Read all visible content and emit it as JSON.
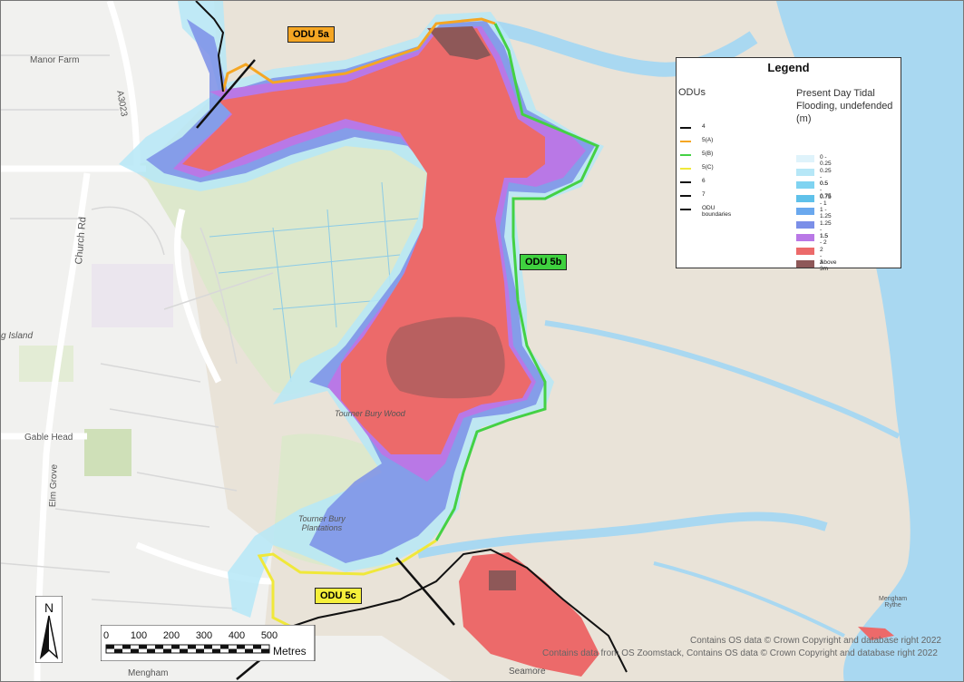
{
  "place_labels": {
    "manor_farm": "Manor Farm",
    "a3023": "A3023",
    "church_rd": "Church Rd",
    "island": "g Island",
    "gable_head": "Gable Head",
    "elm_grove": "Elm Grove",
    "tourner_bury_wood": "Tourner Bury Wood",
    "tourner_bury_plantations": "Tourner Bury\nPlantations",
    "mengham": "Mengham",
    "mengham_rythe": "Mengham\nRythe",
    "seamore": "Seamore"
  },
  "odu_labels": {
    "odu_5a": {
      "text": "ODU 5a",
      "color": "#f5a623"
    },
    "odu_5b": {
      "text": "ODU 5b",
      "color": "#3fd13f"
    },
    "odu_5c": {
      "text": "ODU 5c",
      "color": "#f5ef3a"
    }
  },
  "legend": {
    "title": "Legend",
    "odu_heading": "ODUs",
    "flood_heading": "Present Day Tidal Flooding, undefended (m)",
    "odu_items": [
      {
        "label": "4",
        "color": "#111111"
      },
      {
        "label": "5(A)",
        "color": "#f5a623"
      },
      {
        "label": "5(B)",
        "color": "#44d144"
      },
      {
        "label": "5(C)",
        "color": "#f0e83a"
      },
      {
        "label": "6",
        "color": "#111111"
      },
      {
        "label": "7",
        "color": "#111111"
      },
      {
        "label": "ODU boundaries",
        "color": "#111111"
      }
    ],
    "flood_items": [
      {
        "label": "0 - 0.25",
        "color": "#dff3fb"
      },
      {
        "label": "0.25 - 0.5",
        "color": "#b6e7f7"
      },
      {
        "label": "0.5 - 0.75",
        "color": "#7fd3f1"
      },
      {
        "label": "0.75 - 1",
        "color": "#5fc1ea"
      },
      {
        "label": "1 - 1.25",
        "color": "#6aa8ee"
      },
      {
        "label": "1.25 - 1.5",
        "color": "#7b8fe8"
      },
      {
        "label": "1.5 - 2",
        "color": "#b978e6"
      },
      {
        "label": "2 - 3",
        "color": "#ec6a6a"
      },
      {
        "label": "Above 3m",
        "color": "#8e5858"
      }
    ]
  },
  "scale_bar": {
    "ticks": [
      "0",
      "100",
      "200",
      "300",
      "400",
      "500"
    ],
    "unit": "Metres"
  },
  "north_arrow": {
    "label": "N"
  },
  "credits": {
    "line1": "Contains OS data © Crown Copyright and database right 2022",
    "line2": "Contains data from OS Zoomstack, Contains OS data © Crown Copyright and database right 2022"
  },
  "colors": {
    "land": "#e9e3d8",
    "urban": "#f1f1ef",
    "green": "#dde8cc",
    "water": "#a9d8f1",
    "flood_high": "#ec6a6a",
    "flood_max": "#8e5858",
    "flood_mid": "#b978e6",
    "flood_low": "#7fd3f1"
  }
}
